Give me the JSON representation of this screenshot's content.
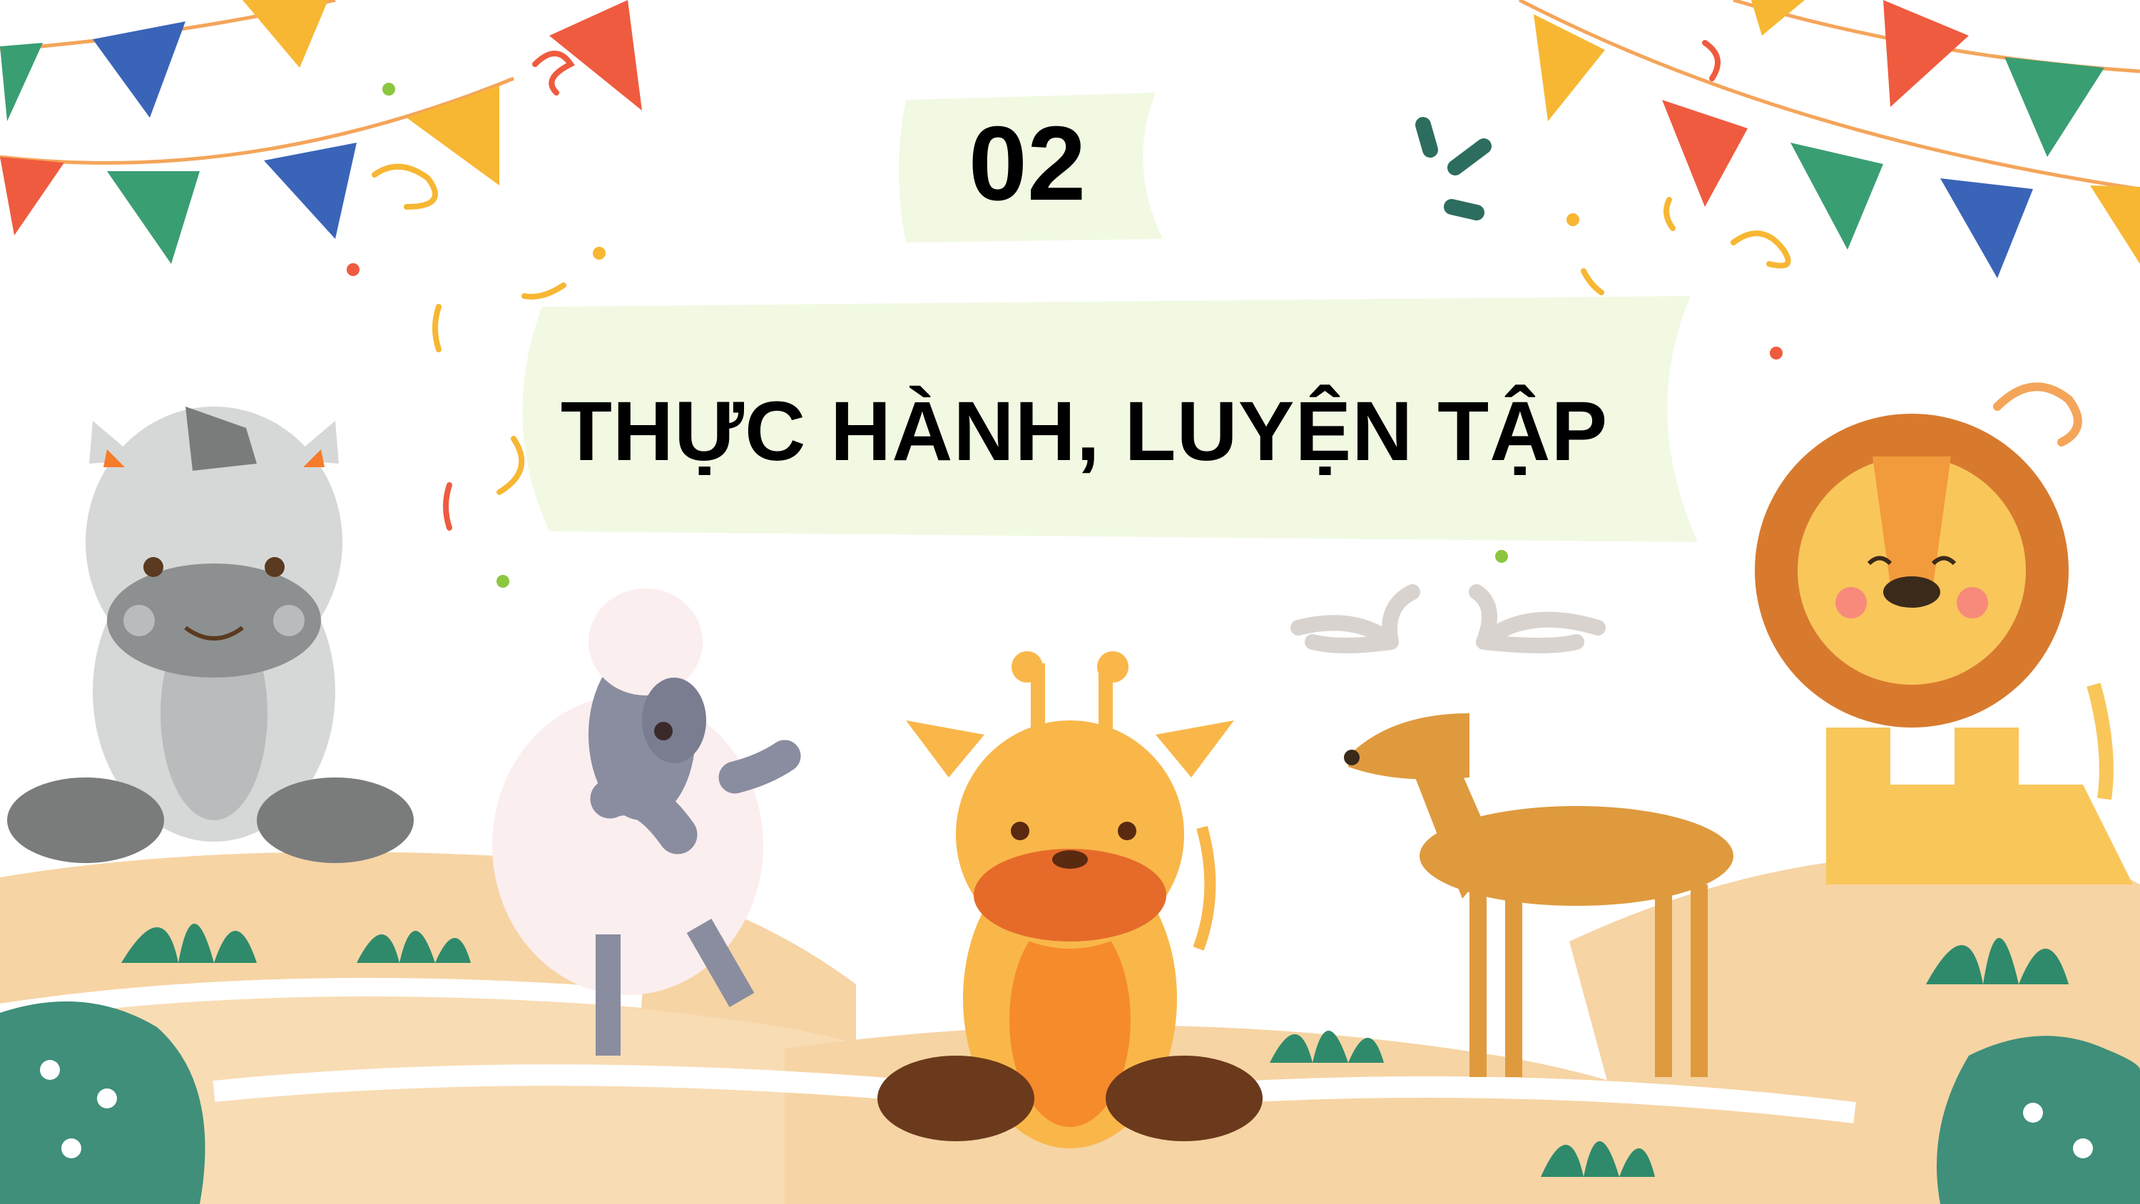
{
  "slide": {
    "section_number": "02",
    "title": "THỰC HÀNH, LUYỆN TẬP"
  },
  "colors": {
    "background": "#ffffff",
    "highlight_band": "#f1f9e3",
    "sand": "#f6d4a4",
    "bunting_yellow": "#f7b733",
    "bunting_green": "#3a9e73",
    "bunting_blue": "#3a64b8",
    "bunting_red": "#ef5b3f",
    "leaf_green": "#3f8f7a"
  },
  "decorations": [
    "bunting-flags",
    "confetti",
    "zebra",
    "sheep",
    "giraffe",
    "deer",
    "lion",
    "monstera-leaf",
    "grass-tufts",
    "sand-hills"
  ]
}
